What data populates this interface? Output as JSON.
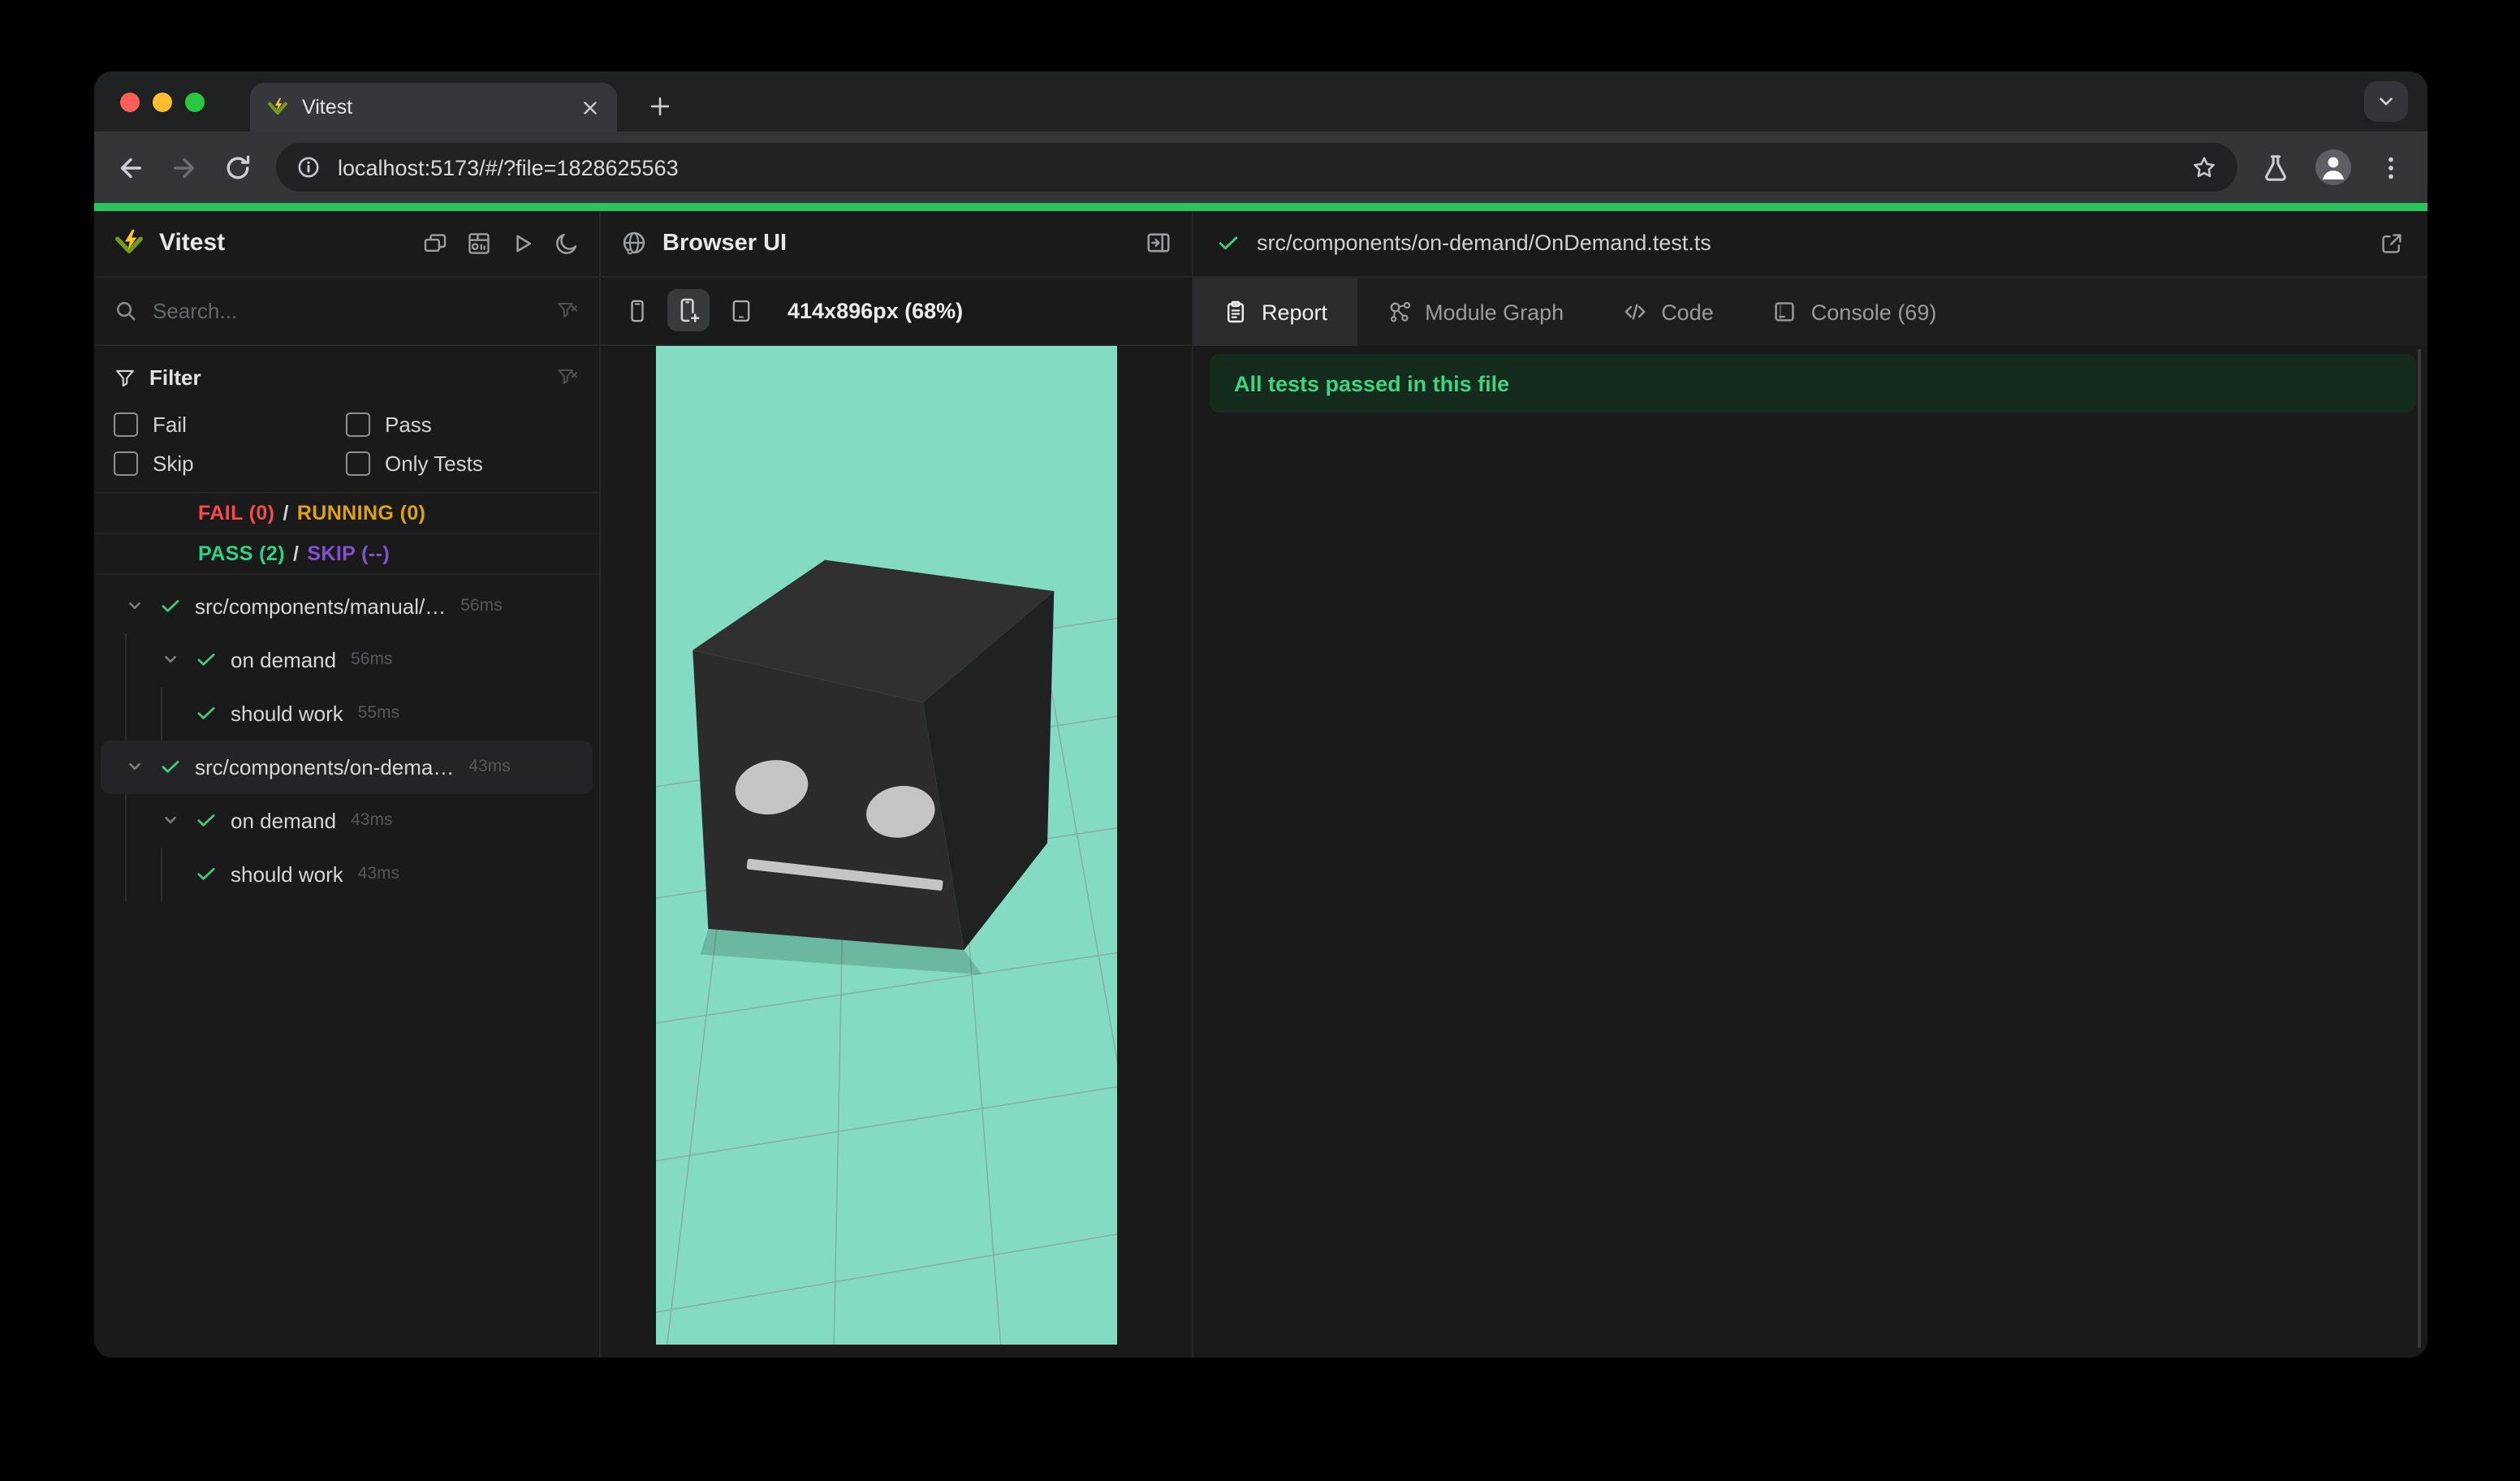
{
  "browser": {
    "tab_title": "Vitest",
    "url": "localhost:5173/#/?file=1828625563"
  },
  "sidebar": {
    "app_name": "Vitest",
    "search_placeholder": "Search...",
    "filter": {
      "title": "Filter",
      "options": [
        "Fail",
        "Pass",
        "Skip",
        "Only Tests"
      ]
    },
    "status": {
      "fail": "FAIL (0)",
      "running": "RUNNING (0)",
      "pass": "PASS (2)",
      "skip": "SKIP (--)",
      "sep": "/"
    },
    "tree": [
      {
        "level": 0,
        "expandable": true,
        "label": "src/components/manual/…",
        "duration": "56ms",
        "selected": false
      },
      {
        "level": 1,
        "expandable": true,
        "label": "on demand",
        "duration": "56ms",
        "selected": false
      },
      {
        "level": 2,
        "expandable": false,
        "label": "should work",
        "duration": "55ms",
        "selected": false
      },
      {
        "level": 0,
        "expandable": true,
        "label": "src/components/on-dema…",
        "duration": "43ms",
        "selected": true
      },
      {
        "level": 1,
        "expandable": true,
        "label": "on demand",
        "duration": "43ms",
        "selected": false
      },
      {
        "level": 2,
        "expandable": false,
        "label": "should work",
        "duration": "43ms",
        "selected": false
      }
    ]
  },
  "browser_panel": {
    "title": "Browser UI",
    "viewport": "414x896px (68%)"
  },
  "report_panel": {
    "file_path": "src/components/on-demand/OnDemand.test.ts",
    "tabs": [
      {
        "label": "Report",
        "icon": "clipboard-icon",
        "active": true
      },
      {
        "label": "Module Graph",
        "icon": "module-graph-icon",
        "active": false
      },
      {
        "label": "Code",
        "icon": "code-icon",
        "active": false
      },
      {
        "label": "Console (69)",
        "icon": "console-icon",
        "active": false
      }
    ],
    "banner": "All tests passed in this file"
  },
  "colors": {
    "progress": "#2cc45c",
    "viewport_bg": "#83dcc2",
    "fail": "#f74b4b",
    "running": "#dba30f",
    "pass": "#2fd283",
    "skip": "#8250d0",
    "check": "#40c97e",
    "banner_bg": "#142b1d",
    "banner_text": "#3ed47d"
  }
}
